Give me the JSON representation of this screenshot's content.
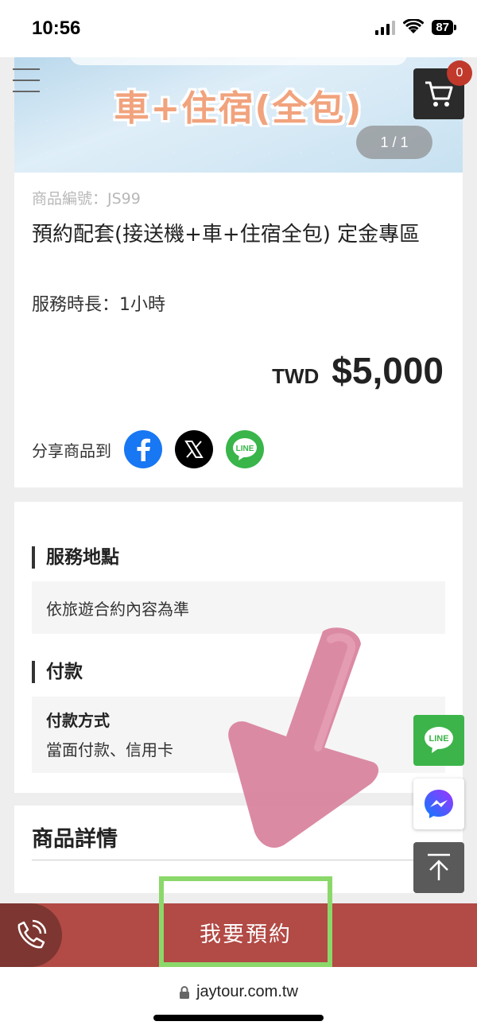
{
  "status_bar": {
    "time": "10:56",
    "battery": "87"
  },
  "hero": {
    "banner_text": "車+住宿(全包)",
    "pager": "1 / 1"
  },
  "header": {
    "cart_count": "0"
  },
  "product": {
    "sku": "商品編號：JS99",
    "title": "預約配套(接送機+車+住宿全包) 定金專區",
    "duration": "服務時長：1小時",
    "currency": "TWD",
    "price": "$5,000",
    "share_label": "分享商品到"
  },
  "info": {
    "location_heading": "服務地點",
    "location_value": "依旅遊合約內容為準",
    "payment_heading": "付款",
    "payment_method_label": "付款方式",
    "payment_method_value": "當面付款、信用卡"
  },
  "details": {
    "title": "商品詳情"
  },
  "booking": {
    "book_label": "我要預約"
  },
  "browser": {
    "url": "jaytour.com.tw"
  },
  "colors": {
    "book_bar": "#b24a45",
    "phone_btn": "#7d3631",
    "highlight": "#8bd86a",
    "line_green": "#3cb44a",
    "facebook": "#1877f2",
    "annotation_arrow": "#d8809c"
  },
  "icons": [
    "hamburger-menu-icon",
    "cart-icon",
    "facebook-icon",
    "x-icon",
    "line-icon",
    "messenger-icon",
    "back-to-top-icon",
    "phone-icon",
    "lock-icon"
  ]
}
